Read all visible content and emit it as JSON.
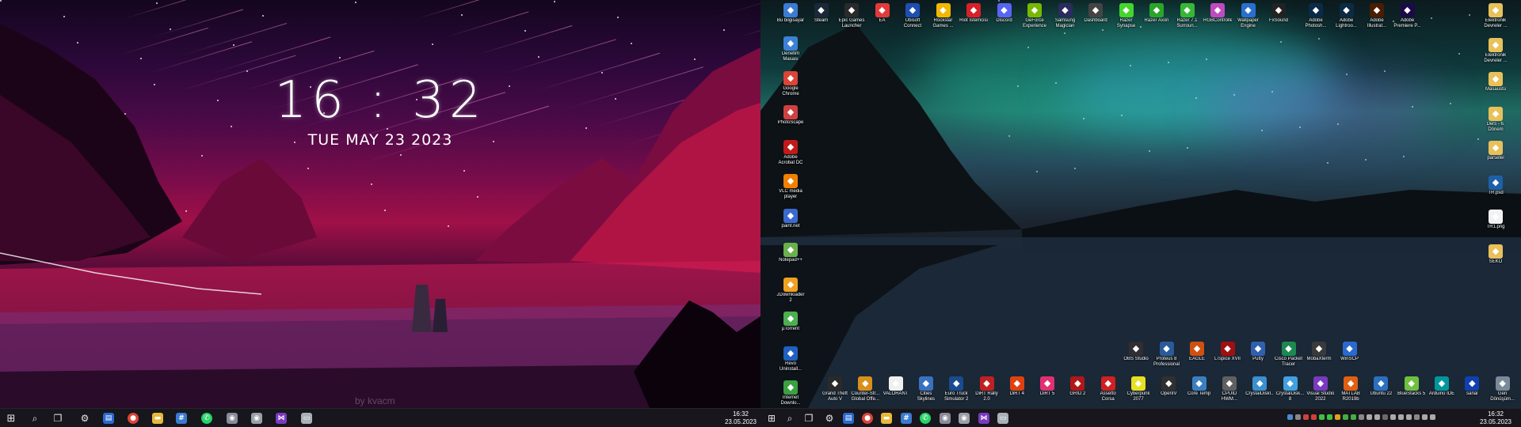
{
  "clock_widget": {
    "time": "16 : 32",
    "date": "TUE MAY 23 2023"
  },
  "left_watermark": "by kvacm",
  "taskbar_left": {
    "clock_time": "16:32",
    "clock_date": "23.05.2023",
    "items": [
      "start-icon",
      "search-icon",
      "task-view-icon",
      "settings-icon",
      "store-icon",
      "chrome-icon",
      "file-explorer-icon",
      "calculator-icon",
      "whatsapp-icon",
      "app-icon",
      "app-icon",
      "visual-studio-icon",
      "app-icon"
    ]
  },
  "taskbar_right": {
    "clock_time": "16:32",
    "clock_date": "23.05.2023"
  },
  "desktop_top_row": [
    {
      "label": "Bu bilgisayar",
      "icon": "computer-icon",
      "color": "#3a7bd5"
    },
    {
      "label": "Steam",
      "icon": "steam-icon",
      "color": "#1b2838"
    },
    {
      "label": "Epic Games Launcher",
      "icon": "epic-icon",
      "color": "#2a2a2a"
    },
    {
      "label": "EA",
      "icon": "ea-icon",
      "color": "#e23a3a"
    },
    {
      "label": "Ubisoft Connect",
      "icon": "ubisoft-icon",
      "color": "#1e4fb0"
    },
    {
      "label": "Rockstar Games ...",
      "icon": "rockstar-icon",
      "color": "#f2b800"
    },
    {
      "label": "Riot İstemcisi",
      "icon": "riot-icon",
      "color": "#d8202a"
    },
    {
      "label": "Discord",
      "icon": "discord-icon",
      "color": "#5865f2"
    },
    {
      "label": "GeForce Experience",
      "icon": "geforce-icon",
      "color": "#76b900"
    },
    {
      "label": "Samsung Magician",
      "icon": "samsung-icon",
      "color": "#2b2b5e"
    },
    {
      "label": "Dashboard",
      "icon": "dashboard-icon",
      "color": "#444"
    },
    {
      "label": "Razer Synapse",
      "icon": "razer-icon",
      "color": "#44d62c"
    },
    {
      "label": "Razer Axon",
      "icon": "razer-axon-icon",
      "color": "#2aa52a"
    },
    {
      "label": "Razer 7.1 Surroun...",
      "icon": "razer-surround-icon",
      "color": "#36b836"
    },
    {
      "label": "RGBController",
      "icon": "rgb-icon",
      "color": "#c04ac0"
    },
    {
      "label": "Wallpaper Engine",
      "icon": "wallpaper-engine-icon",
      "color": "#2a6fd0"
    },
    {
      "label": "FxSound",
      "icon": "fxsound-icon",
      "color": "#222"
    }
  ],
  "desktop_top_right": [
    {
      "label": "Adobe Photosh...",
      "icon": "photoshop-icon",
      "color": "#0a2a4a"
    },
    {
      "label": "Adobe Lightroo...",
      "icon": "lightroom-icon",
      "color": "#0c2a44"
    },
    {
      "label": "Adobe Illustrat...",
      "icon": "illustrator-icon",
      "color": "#4a1c00"
    },
    {
      "label": "Adobe Premiere P...",
      "icon": "premiere-icon",
      "color": "#1a0a4a"
    }
  ],
  "desktop_left_column": [
    {
      "label": "Denetim Masası",
      "icon": "control-panel-icon",
      "color": "#3b82d6"
    },
    {
      "label": "Google Chrome",
      "icon": "chrome-icon",
      "color": "#db4437"
    },
    {
      "label": "PhotoScape",
      "icon": "photoscape-icon",
      "color": "#d04040"
    },
    {
      "label": "Adobe Acrobat DC",
      "icon": "acrobat-icon",
      "color": "#c21a1a"
    },
    {
      "label": "VLC media player",
      "icon": "vlc-icon",
      "color": "#f08000"
    },
    {
      "label": "paint.net",
      "icon": "paintnet-icon",
      "color": "#3a6ad0"
    },
    {
      "label": "Notepad++",
      "icon": "notepadpp-icon",
      "color": "#6ab04c"
    },
    {
      "label": "JDownloader 2",
      "icon": "jdownloader-icon",
      "color": "#f0a020"
    },
    {
      "label": "µTorrent",
      "icon": "utorrent-icon",
      "color": "#4caf50"
    },
    {
      "label": "Revo Uninstall...",
      "icon": "revo-icon",
      "color": "#2060c0"
    },
    {
      "label": "Internet Downlo...",
      "icon": "idm-icon",
      "color": "#3aa040"
    }
  ],
  "desktop_right_column": [
    {
      "label": "Elektronik Devreler ...",
      "icon": "folder-icon",
      "color": "#e8c15a"
    },
    {
      "label": "Elektronik Devreler ...",
      "icon": "folder-icon",
      "color": "#e8c15a"
    },
    {
      "label": "Masaüstü",
      "icon": "folder-icon",
      "color": "#e8c15a"
    },
    {
      "label": "Ders - 6. Dönem",
      "icon": "folder-icon",
      "color": "#e8c15a"
    },
    {
      "label": "parsetel",
      "icon": "folder-icon",
      "color": "#e8c15a"
    },
    {
      "label": "TR.psd",
      "icon": "psd-file-icon",
      "color": "#1f5fa8"
    },
    {
      "label": "TR1.png",
      "icon": "png-file-icon",
      "color": "#f2f2f2"
    },
    {
      "label": "SEKO",
      "icon": "folder-icon",
      "color": "#e8c15a"
    }
  ],
  "desktop_bottom_upper": [
    {
      "label": "OBS Studio",
      "icon": "obs-icon",
      "color": "#302e31"
    },
    {
      "label": "Proteus 8 Professional",
      "icon": "proteus-icon",
      "color": "#2a5a9a"
    },
    {
      "label": "EAGLE",
      "icon": "eagle-icon",
      "color": "#d05010"
    },
    {
      "label": "LTspice XVII",
      "icon": "ltspice-icon",
      "color": "#a01010"
    },
    {
      "label": "Putty",
      "icon": "putty-icon",
      "color": "#3060b0"
    },
    {
      "label": "Cisco Packet Tracer",
      "icon": "packet-tracer-icon",
      "color": "#1a8a50"
    },
    {
      "label": "MobaXterm",
      "icon": "mobaxterm-icon",
      "color": "#3a3a3a"
    },
    {
      "label": "WinSCP",
      "icon": "winscp-icon",
      "color": "#2a6ad0"
    }
  ],
  "desktop_bottom_lower": [
    {
      "label": "Grand Theft Auto V",
      "icon": "gta-icon",
      "color": "#2a2a2a"
    },
    {
      "label": "Counter-Str... Global Offe...",
      "icon": "csgo-icon",
      "color": "#d8901a"
    },
    {
      "label": "VALORANT",
      "icon": "valorant-icon",
      "color": "#f0f0f0"
    },
    {
      "label": "Cities Skylines",
      "icon": "cities-icon",
      "color": "#3a70c0"
    },
    {
      "label": "Euro Truck Simulator 2",
      "icon": "ets2-icon",
      "color": "#1a4a90"
    },
    {
      "label": "DiRT Rally 2.0",
      "icon": "dirt-rally-icon",
      "color": "#c02020"
    },
    {
      "label": "DiRT 4",
      "icon": "dirt4-icon",
      "color": "#e04010"
    },
    {
      "label": "DiRT 5",
      "icon": "dirt5-icon",
      "color": "#e03070"
    },
    {
      "label": "GRID 2",
      "icon": "grid2-icon",
      "color": "#b01818"
    },
    {
      "label": "Assetto Corsa",
      "icon": "assetto-icon",
      "color": "#d02020"
    },
    {
      "label": "Cyberpunk 2077",
      "icon": "cyberpunk-icon",
      "color": "#e8e020"
    },
    {
      "label": "OpenIV",
      "icon": "openiv-icon",
      "color": "#303030"
    },
    {
      "label": "Core Temp",
      "icon": "coretemp-icon",
      "color": "#3a80c0"
    },
    {
      "label": "CPUID HWM...",
      "icon": "cpuid-icon",
      "color": "#606060"
    },
    {
      "label": "CrystalDiskI...",
      "icon": "crystaldisk-icon",
      "color": "#3a90d0"
    },
    {
      "label": "CrystalDisk... 8",
      "icon": "crystaldisk8-icon",
      "color": "#40a0e0"
    },
    {
      "label": "Visual Studio 2022",
      "icon": "visual-studio-icon",
      "color": "#7a3ac0"
    },
    {
      "label": "MATLAB R2019b",
      "icon": "matlab-icon",
      "color": "#e06010"
    },
    {
      "label": "Ubuntu 22",
      "icon": "ubuntu-icon",
      "color": "#2a70c0"
    },
    {
      "label": "BlueStacks 5",
      "icon": "bluestacks-icon",
      "color": "#70c040"
    },
    {
      "label": "Arduino IDE",
      "icon": "arduino-icon",
      "color": "#00979c"
    },
    {
      "label": "sanal",
      "icon": "virtualbox-icon",
      "color": "#1040b0"
    },
    {
      "label": "Geri Dönüşüm...",
      "icon": "recycle-bin-icon",
      "color": "#7a8a9a"
    }
  ]
}
